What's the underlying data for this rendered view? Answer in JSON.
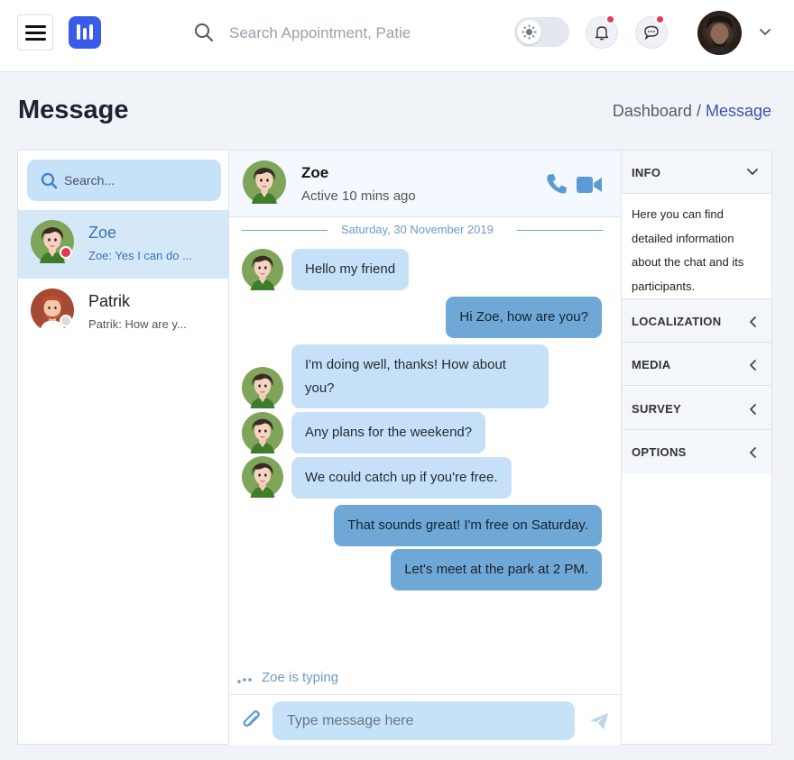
{
  "topbar": {
    "search_placeholder": "Search Appointment, Patient or pages",
    "notifications_has_unread": true,
    "messages_has_unread": true,
    "theme": "light"
  },
  "page": {
    "title": "Message",
    "breadcrumb": [
      "Dashboard",
      "Message"
    ]
  },
  "contacts": {
    "search_placeholder": "Search...",
    "items": [
      {
        "name": "Zoe",
        "preview": "Zoe: Yes I can do ...",
        "status_color": "#e53950",
        "active": true
      },
      {
        "name": "Patrik",
        "preview": "Patrik: How are y...",
        "status_color": "#dcdcdc",
        "active": false
      }
    ]
  },
  "chat": {
    "name": "Zoe",
    "status": "Active 10 mins ago",
    "date_divider": "Saturday, 30 November 2019",
    "messages": [
      {
        "dir": "in",
        "text": "Hello my friend"
      },
      {
        "dir": "out",
        "text": "Hi Zoe, how are you?"
      },
      {
        "dir": "in",
        "text_line1": "I'm doing well, thanks! How about",
        "text_line2": "you?"
      },
      {
        "dir": "in",
        "text": "Any plans for the weekend?"
      },
      {
        "dir": "in",
        "text": "We could catch up if you're free."
      },
      {
        "dir": "out",
        "text": "That sounds great! I'm free on Saturday."
      },
      {
        "dir": "out",
        "text": "Let's meet at the park at 2 PM."
      }
    ],
    "typing": "Zoe is typing",
    "input_placeholder": "Type message here"
  },
  "info_panel": {
    "sections": [
      {
        "label": "INFO",
        "expanded": true,
        "body": "Here you can find detailed information about the chat and its participants."
      },
      {
        "label": "LOCALIZATION",
        "expanded": false
      },
      {
        "label": "MEDIA",
        "expanded": false
      },
      {
        "label": "SURVEY",
        "expanded": false
      },
      {
        "label": "OPTIONS",
        "expanded": false
      }
    ]
  },
  "colors": {
    "accent": "#3f51b5",
    "bubble_in": "#c6e1f7",
    "bubble_out": "#6fa8d6",
    "unread_dot": "#e53950",
    "icon_blue": "#5b9bd5"
  }
}
